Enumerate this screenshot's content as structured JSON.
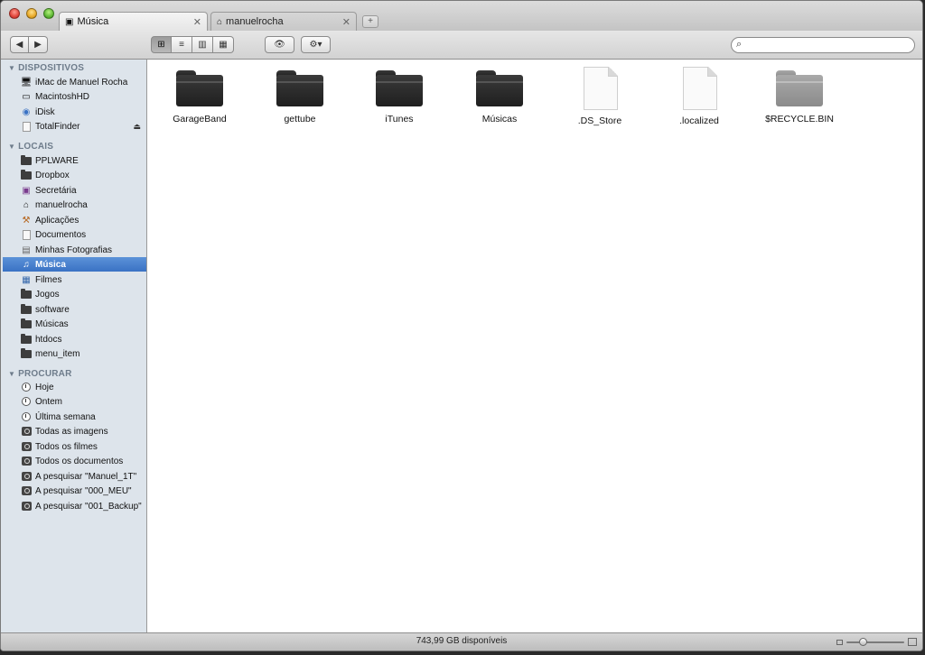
{
  "window": {
    "tabs": [
      {
        "label": "Música",
        "icon": "music-folder-icon"
      },
      {
        "label": "manuelrocha",
        "icon": "home-icon"
      }
    ]
  },
  "toolbar": {
    "back_label": "◀",
    "forward_label": "▶",
    "view_modes": [
      "icon-view",
      "list-view",
      "column-view",
      "coverflow-view"
    ],
    "active_view": "icon-view",
    "quicklook_label": "👁",
    "action_label": "⚙▾",
    "search": {
      "value": "",
      "placeholder": ""
    }
  },
  "sidebar": {
    "sections": [
      {
        "header": "DISPOSITIVOS",
        "items": [
          {
            "label": "iMac de Manuel Rocha",
            "icon": "imac-icon"
          },
          {
            "label": "MacintoshHD",
            "icon": "hard-drive-icon"
          },
          {
            "label": "iDisk",
            "icon": "idisk-icon"
          },
          {
            "label": "TotalFinder",
            "icon": "document-icon",
            "eject": "⏏"
          }
        ]
      },
      {
        "header": "LOCAIS",
        "items": [
          {
            "label": "PPLWARE",
            "icon": "folder-icon"
          },
          {
            "label": "Dropbox",
            "icon": "folder-icon"
          },
          {
            "label": "Secretária",
            "icon": "desktop-icon"
          },
          {
            "label": "manuelrocha",
            "icon": "home-icon"
          },
          {
            "label": "Aplicações",
            "icon": "applications-icon"
          },
          {
            "label": "Documentos",
            "icon": "documents-icon"
          },
          {
            "label": "Minhas Fotografias",
            "icon": "pictures-icon"
          },
          {
            "label": "Música",
            "icon": "music-icon",
            "selected": true
          },
          {
            "label": "Filmes",
            "icon": "movies-icon"
          },
          {
            "label": "Jogos",
            "icon": "games-icon"
          },
          {
            "label": "software",
            "icon": "folder-icon"
          },
          {
            "label": "Músicas",
            "icon": "folder-icon"
          },
          {
            "label": "htdocs",
            "icon": "folder-icon"
          },
          {
            "label": "menu_item",
            "icon": "folder-icon"
          }
        ]
      },
      {
        "header": "PROCURAR",
        "items": [
          {
            "label": "Hoje",
            "icon": "clock-icon"
          },
          {
            "label": "Ontem",
            "icon": "clock-icon"
          },
          {
            "label": "Última semana",
            "icon": "clock-icon"
          },
          {
            "label": "Todas as imagens",
            "icon": "smart-folder-icon"
          },
          {
            "label": "Todos os filmes",
            "icon": "smart-folder-icon"
          },
          {
            "label": "Todos os documentos",
            "icon": "smart-folder-icon"
          },
          {
            "label": "A pesquisar \"Manuel_1T\"",
            "icon": "smart-folder-icon"
          },
          {
            "label": "A pesquisar \"000_MEU\"",
            "icon": "smart-folder-icon"
          },
          {
            "label": "A pesquisar \"001_Backup\"",
            "icon": "smart-folder-icon"
          }
        ]
      }
    ]
  },
  "content": {
    "items": [
      {
        "label": "GarageBand",
        "kind": "folder-dark"
      },
      {
        "label": "gettube",
        "kind": "folder-dark"
      },
      {
        "label": "iTunes",
        "kind": "folder-dark"
      },
      {
        "label": "Músicas",
        "kind": "folder-dark"
      },
      {
        "label": ".DS_Store",
        "kind": "document"
      },
      {
        "label": ".localized",
        "kind": "document"
      },
      {
        "label": "$RECYCLE.BIN",
        "kind": "folder-grey"
      }
    ]
  },
  "statusbar": {
    "text": "743,99 GB disponíveis",
    "zoom_level": 0.25
  },
  "colors": {
    "selection": "#3a72c4",
    "sidebar_bg": "#dde4eb",
    "section_header": "#6e7c8b"
  }
}
